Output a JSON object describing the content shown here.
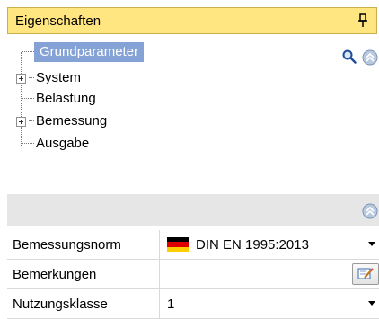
{
  "panel": {
    "title": "Eigenschaften",
    "pin_icon": "pin-icon"
  },
  "tree": {
    "items": [
      {
        "label": "Grundparameter",
        "selected": true,
        "expandable": false
      },
      {
        "label": "System",
        "selected": false,
        "expandable": true
      },
      {
        "label": "Belastung",
        "selected": false,
        "expandable": false
      },
      {
        "label": "Bemessung",
        "selected": false,
        "expandable": true
      },
      {
        "label": "Ausgabe",
        "selected": false,
        "expandable": false
      }
    ],
    "search_icon": "search-icon",
    "collapse_icon": "collapse-up-icon"
  },
  "properties": {
    "collapse_icon": "collapse-up-icon",
    "rows": [
      {
        "name": "Bemessungsnorm",
        "value": "DIN EN 1995:2013",
        "flag": "germany-flag-icon",
        "control": "dropdown"
      },
      {
        "name": "Bemerkungen",
        "value": "",
        "control": "edit-button"
      },
      {
        "name": "Nutzungsklasse",
        "value": "1",
        "control": "dropdown"
      }
    ]
  },
  "colors": {
    "header_background": "#ffe680",
    "selection": "#5d83c9",
    "group_bar": "#e6e6e6",
    "flag_black": "#000000",
    "flag_red": "#dd0000",
    "flag_gold": "#ffce00"
  }
}
